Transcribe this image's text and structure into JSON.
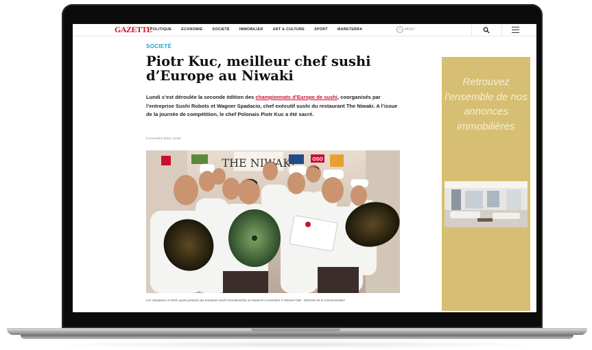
{
  "site": {
    "logo_text": "GAZETTE",
    "nav_items": [
      "POLITIQUE",
      "ECONOMIE",
      "SOCIETÉ",
      "IMMOBILIER",
      "ART & CULTURE",
      "SPORT",
      "MARETERRA"
    ],
    "menu_label": "MENU",
    "search_icon": "search-icon",
    "hamburger_icon": "hamburger-menu-icon",
    "brand_color": "#c8102e",
    "accent_color": "#1da3c9"
  },
  "article": {
    "category": "SOCIETÉ",
    "title": "Piotr Kuc, meilleur chef sushi d’Europe au Niwaki",
    "lede_before": "Lundi s’est déroulée la seconde édition des ",
    "lede_link": "championnats d’Europe de sushi",
    "lede_after": ", coorganisés par l’entreprise Sushi Robots et Wagner Spadacio, chef exécutif sushi du restaurant The Niwaki. A l’issue de la journée de compétition, le chef Polonais Piotr Kuc a été sacré.",
    "date": "6 novembre 2024, 11h40",
    "photo_banner_text": "THE NIWAKI",
    "photo_sign_text": "OSO",
    "caption": "Les vainqueurs et chefs ayant participé aux European Sushi Championship au Niwaki le 4 novembre © Manuel Vitali - Direction de la Communication"
  },
  "ad": {
    "text": "Retrouvez l'ensemble de nos annonces immobilières",
    "background": "#d6bf72"
  }
}
